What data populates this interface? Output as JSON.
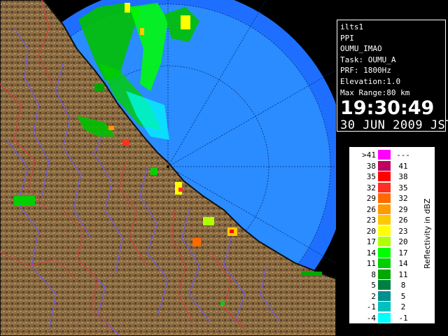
{
  "info_panel": {
    "site": "ilts1",
    "product": "PPI",
    "station": "OUMU_IMAO",
    "task": "Task: OUMU_A",
    "prf": "PRF: 1800Hz",
    "elevation": "Elevation:1.0",
    "max_range": "Max Range:80 km",
    "time": "19:30:49",
    "date": "30 JUN 2009 JST"
  },
  "legend": {
    "title": "Reflectivity in dBZ",
    "rows": [
      {
        "lo": ">41",
        "hi": "---",
        "color": "#ff00ff"
      },
      {
        "lo": "38",
        "hi": "41",
        "color": "#c00060"
      },
      {
        "lo": "35",
        "hi": "38",
        "color": "#ff0000"
      },
      {
        "lo": "32",
        "hi": "35",
        "color": "#ff3020"
      },
      {
        "lo": "29",
        "hi": "32",
        "color": "#ff6a00"
      },
      {
        "lo": "26",
        "hi": "29",
        "color": "#ff9a00"
      },
      {
        "lo": "23",
        "hi": "26",
        "color": "#ffc800"
      },
      {
        "lo": "20",
        "hi": "23",
        "color": "#ffff00"
      },
      {
        "lo": "17",
        "hi": "20",
        "color": "#b0ff00"
      },
      {
        "lo": "14",
        "hi": "17",
        "color": "#00ff00"
      },
      {
        "lo": "11",
        "hi": "14",
        "color": "#00d000"
      },
      {
        "lo": "8",
        "hi": "11",
        "color": "#00a800"
      },
      {
        "lo": "5",
        "hi": "8",
        "color": "#008040"
      },
      {
        "lo": "2",
        "hi": "5",
        "color": "#009090"
      },
      {
        "lo": "-1",
        "hi": "2",
        "color": "#00c0c0"
      },
      {
        "lo": "-4",
        "hi": "-1",
        "color": "#00ffff"
      }
    ]
  },
  "map_colors": {
    "sea_outer": "#1e6fff",
    "sea_inner": "#2a8cff",
    "land": "#8a6a40",
    "coast": "#101010",
    "rivers": "#6a5aff",
    "borders": "#d04040"
  }
}
